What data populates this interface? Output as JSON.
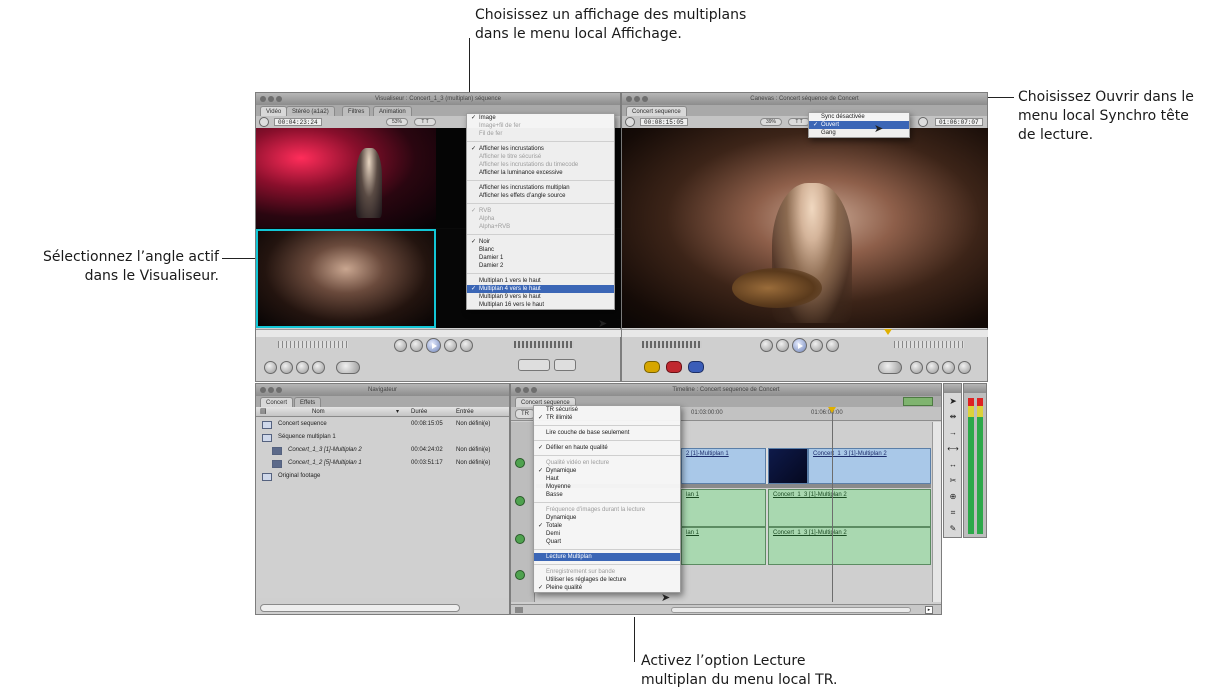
{
  "callouts": {
    "top_l1": "Choisissez un affichage des multiplans",
    "top_l2": "dans le menu local Affichage.",
    "right_l1": "Choisissez Ouvrir dans le",
    "right_l2": "menu local Synchro tête",
    "right_l3": "de lecture.",
    "left_l1": "Sélectionnez l’angle actif",
    "left_l2": "dans le Visualiseur.",
    "bottom_l1": "Activez l’option Lecture",
    "bottom_l2": "multiplan du menu local TR."
  },
  "viewer": {
    "title": "Visualiseur : Concert_1_3 (multiplan) séquence",
    "tabs": [
      "Vidéo",
      "Stéréo (a1a2)",
      "Filtres",
      "Animation"
    ],
    "timecode": "00:04:23:24",
    "zoom": "53%",
    "view_btn": "T T"
  },
  "canvas": {
    "title": "Canevas : Concert séquence de Concert",
    "tab": "Concert sequence",
    "timecode": "00:08:15:05",
    "zoom": "39%",
    "timecode_right": "01:06:07:07"
  },
  "view_menu": {
    "items": [
      {
        "label": "Image",
        "check": "✓",
        "state": "normal"
      },
      {
        "label": "Image+fil de fer",
        "check": "",
        "state": "disabled"
      },
      {
        "label": "Fil de fer",
        "check": "",
        "state": "disabled"
      },
      {
        "sep": true
      },
      {
        "label": "Afficher les incrustations",
        "check": "✓",
        "state": "normal"
      },
      {
        "label": "Afficher le titre sécurisé",
        "check": "",
        "state": "disabled"
      },
      {
        "label": "Afficher les incrustations du timecode",
        "check": "",
        "state": "disabled"
      },
      {
        "label": "Afficher la luminance excessive",
        "check": "",
        "state": "normal"
      },
      {
        "sep": true
      },
      {
        "label": "Afficher les incrustations multiplan",
        "check": "",
        "state": "normal"
      },
      {
        "label": "Afficher les effets d’angle source",
        "check": "",
        "state": "normal"
      },
      {
        "sep": true
      },
      {
        "label": "RVB",
        "check": "✓",
        "state": "disabled"
      },
      {
        "label": "Alpha",
        "check": "",
        "state": "disabled"
      },
      {
        "label": "Alpha+RVB",
        "check": "",
        "state": "disabled"
      },
      {
        "sep": true
      },
      {
        "label": "Noir",
        "check": "✓",
        "state": "normal"
      },
      {
        "label": "Blanc",
        "check": "",
        "state": "normal"
      },
      {
        "label": "Damier 1",
        "check": "",
        "state": "normal"
      },
      {
        "label": "Damier 2",
        "check": "",
        "state": "normal"
      },
      {
        "sep": true
      },
      {
        "label": "Multiplan 1 vers le haut",
        "check": "",
        "state": "normal"
      },
      {
        "label": "Multiplan 4 vers le haut",
        "check": "✓",
        "state": "selected"
      },
      {
        "label": "Multiplan 9 vers le haut",
        "check": "",
        "state": "normal"
      },
      {
        "label": "Multiplan 16 vers le haut",
        "check": "",
        "state": "normal"
      }
    ]
  },
  "sync_menu": {
    "items": [
      {
        "label": "Sync désactivée",
        "check": "",
        "state": "normal"
      },
      {
        "label": "Ouvert",
        "check": "✓",
        "state": "selected"
      },
      {
        "label": "Gang",
        "check": "",
        "state": "normal"
      }
    ]
  },
  "browser": {
    "title": "Navigateur",
    "tabs": [
      "Concert",
      "Effets"
    ],
    "columns": [
      "Nom",
      "Durée",
      "Entrée"
    ],
    "rows": [
      {
        "name": "Concert sequence",
        "duration": "00:08:15:05",
        "in": "Non défini(e)",
        "indent": 0,
        "italic": false
      },
      {
        "name": "Séquence multiplan 1",
        "duration": "",
        "in": "",
        "indent": 0,
        "italic": false
      },
      {
        "name": "Concert_1_3 [1]-Multiplan 2",
        "duration": "00:04:24:02",
        "in": "Non défini(e)",
        "indent": 1,
        "italic": true
      },
      {
        "name": "Concert_1_2 [5]-Multiplan 1",
        "duration": "00:03:51:17",
        "in": "Non défini(e)",
        "indent": 1,
        "italic": true
      },
      {
        "name": "Original footage",
        "duration": "",
        "in": "",
        "indent": 0,
        "italic": false
      }
    ]
  },
  "timeline": {
    "title": "Timeline : Concert sequence de Concert",
    "tab": "Concert sequence",
    "rt_button": "TR",
    "ruler_a": "01:03:00:00",
    "ruler_b": "01:06:00:00",
    "clips": {
      "v1a": "2 [1]-Multiplan 1",
      "v1b": "Concert_1_3 [1]-Multiplan 2",
      "a1a": "lan 1",
      "a1b": "Concert_1_3 [1]-Multiplan 2",
      "a2a": "lan 1",
      "a2b": "Concert_1_3 [1]-Multiplan 2"
    }
  },
  "rt_menu": {
    "items": [
      {
        "label": "TR sécurisé",
        "check": "",
        "state": "normal"
      },
      {
        "label": "TR illimité",
        "check": "✓",
        "state": "normal"
      },
      {
        "sep": true
      },
      {
        "label": "Lire couche de base seulement",
        "check": "",
        "state": "normal"
      },
      {
        "sep": true
      },
      {
        "label": "Défiler en haute qualité",
        "check": "✓",
        "state": "normal"
      },
      {
        "sep": true
      },
      {
        "label": "Qualité vidéo en lecture",
        "check": "",
        "state": "disabled"
      },
      {
        "label": "Dynamique",
        "check": "✓",
        "state": "normal"
      },
      {
        "label": "Haut",
        "check": "",
        "state": "normal"
      },
      {
        "label": "Moyenne",
        "check": "",
        "state": "normal"
      },
      {
        "label": "Basse",
        "check": "",
        "state": "normal"
      },
      {
        "sep": true
      },
      {
        "label": "Fréquence d’images durant la lecture",
        "check": "",
        "state": "disabled"
      },
      {
        "label": "Dynamique",
        "check": "",
        "state": "normal"
      },
      {
        "label": "Totale",
        "check": "✓",
        "state": "normal"
      },
      {
        "label": "Demi",
        "check": "",
        "state": "normal"
      },
      {
        "label": "Quart",
        "check": "",
        "state": "normal"
      },
      {
        "sep": true
      },
      {
        "label": "Lecture Multiplan",
        "check": "",
        "state": "selected"
      },
      {
        "sep": true
      },
      {
        "label": "Enregistrement sur bande",
        "check": "",
        "state": "disabled"
      },
      {
        "label": "Utiliser les réglages de lecture",
        "check": "",
        "state": "normal"
      },
      {
        "label": "Pleine qualité",
        "check": "✓",
        "state": "normal"
      }
    ]
  },
  "colors": {
    "video_track": "#a9c8e8",
    "audio_track": "#a9d8b0",
    "menu_highlight": "#3b66b6",
    "active_angle": "#12c6d6"
  }
}
